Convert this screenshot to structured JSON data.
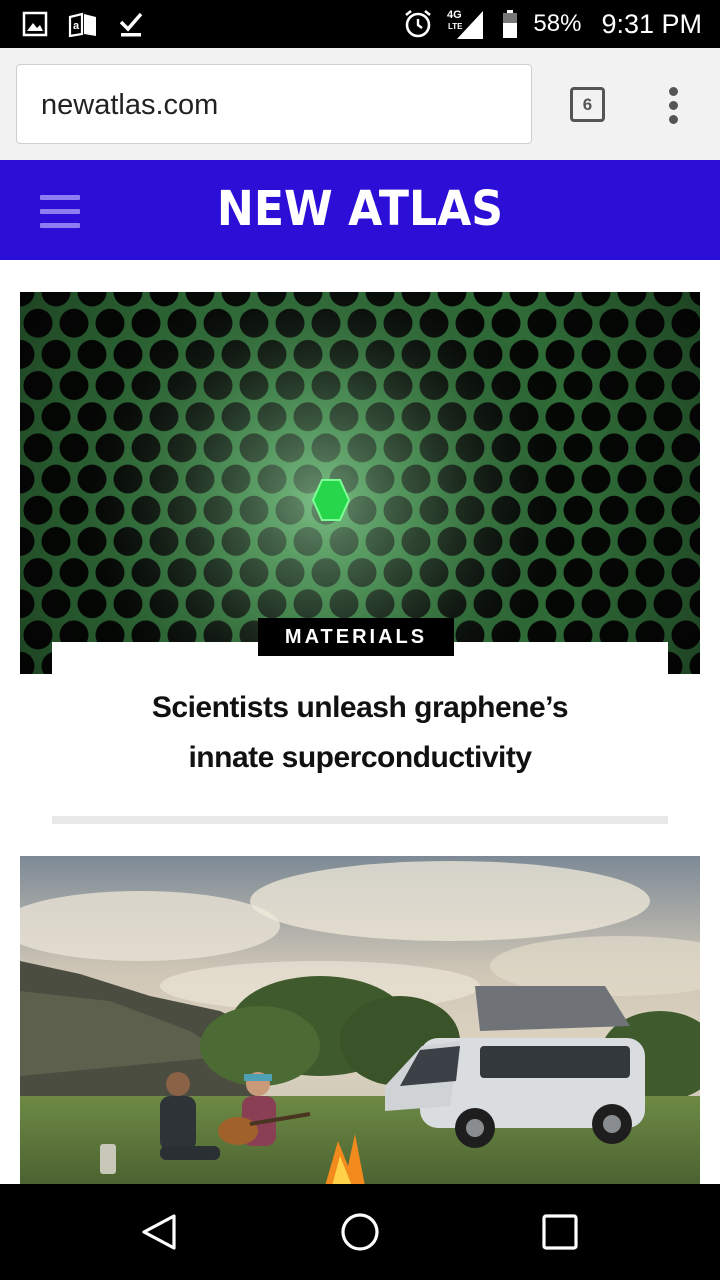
{
  "status_bar": {
    "battery": "58%",
    "time": "9:31 PM",
    "network": "4G LTE",
    "icons": [
      "gallery-icon",
      "amazon-store-icon",
      "download-done-icon",
      "alarm-icon",
      "signal-icon",
      "battery-icon"
    ]
  },
  "browser": {
    "url": "newatlas.com",
    "tab_count": "6",
    "menu_icon": "more-vert-icon"
  },
  "site": {
    "logo": "NEW ATLAS",
    "menu_icon": "hamburger-icon",
    "brand_color": "#2c0fd7"
  },
  "articles": [
    {
      "category": "MATERIALS",
      "headline_line1": "Scientists unleash graphene’s",
      "headline_line2": "innate superconductivity",
      "image": "graphene-hexagon-lattice"
    },
    {
      "image": "campers-guitar-campfire-van"
    }
  ],
  "nav_bar": {
    "icons": [
      "back-icon",
      "home-icon",
      "recents-icon"
    ]
  }
}
